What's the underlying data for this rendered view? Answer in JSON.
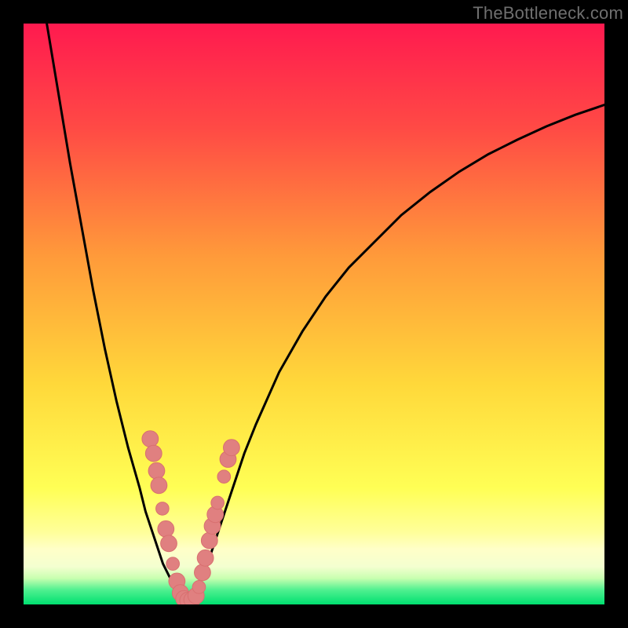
{
  "watermark": "TheBottleneck.com",
  "colors": {
    "gradient_top": "#ff1a4f",
    "gradient_mid_upper": "#ff7a3a",
    "gradient_mid": "#ffd83a",
    "gradient_lower_yellow": "#ffff66",
    "gradient_pale_band": "#ffffc0",
    "gradient_green": "#00e86b",
    "curve": "#000000",
    "marker_fill": "#e08080",
    "marker_stroke": "#d87070"
  },
  "chart_data": {
    "type": "line",
    "title": "",
    "xlabel": "",
    "ylabel": "",
    "xlim": [
      0,
      100
    ],
    "ylim": [
      0,
      100
    ],
    "curve_left": {
      "x": [
        4,
        6,
        8,
        10,
        12,
        14,
        16,
        18,
        20,
        21,
        22,
        23,
        24,
        25,
        26,
        27,
        28
      ],
      "y": [
        100,
        88,
        76,
        65,
        54,
        44,
        35,
        27,
        20,
        16,
        13,
        10,
        7,
        5,
        3,
        1.5,
        0.5
      ]
    },
    "curve_right": {
      "x": [
        28,
        30,
        32,
        34,
        36,
        38,
        40,
        44,
        48,
        52,
        56,
        60,
        65,
        70,
        75,
        80,
        85,
        90,
        95,
        100
      ],
      "y": [
        0.5,
        3,
        8,
        14,
        20,
        26,
        31,
        40,
        47,
        53,
        58,
        62,
        67,
        71,
        74.5,
        77.5,
        80,
        82.3,
        84.3,
        86
      ]
    },
    "markers": [
      {
        "x": 21.8,
        "y": 28.5,
        "r": 2.0
      },
      {
        "x": 22.4,
        "y": 26.0,
        "r": 2.0
      },
      {
        "x": 22.9,
        "y": 23.0,
        "r": 2.0
      },
      {
        "x": 23.3,
        "y": 20.5,
        "r": 2.0
      },
      {
        "x": 23.9,
        "y": 16.5,
        "r": 1.6
      },
      {
        "x": 24.5,
        "y": 13.0,
        "r": 2.0
      },
      {
        "x": 25.0,
        "y": 10.5,
        "r": 2.0
      },
      {
        "x": 25.7,
        "y": 7.0,
        "r": 1.6
      },
      {
        "x": 26.4,
        "y": 4.0,
        "r": 2.0
      },
      {
        "x": 27.0,
        "y": 2.0,
        "r": 2.0
      },
      {
        "x": 27.6,
        "y": 1.0,
        "r": 2.0
      },
      {
        "x": 28.3,
        "y": 0.7,
        "r": 2.0
      },
      {
        "x": 29.0,
        "y": 0.8,
        "r": 2.0
      },
      {
        "x": 29.7,
        "y": 1.5,
        "r": 2.0
      },
      {
        "x": 30.2,
        "y": 3.0,
        "r": 1.6
      },
      {
        "x": 30.8,
        "y": 5.5,
        "r": 2.0
      },
      {
        "x": 31.3,
        "y": 8.0,
        "r": 2.0
      },
      {
        "x": 32.0,
        "y": 11.0,
        "r": 2.0
      },
      {
        "x": 32.5,
        "y": 13.5,
        "r": 2.0
      },
      {
        "x": 33.0,
        "y": 15.5,
        "r": 2.0
      },
      {
        "x": 33.4,
        "y": 17.5,
        "r": 1.6
      },
      {
        "x": 34.5,
        "y": 22.0,
        "r": 1.6
      },
      {
        "x": 35.2,
        "y": 25.0,
        "r": 2.0
      },
      {
        "x": 35.8,
        "y": 27.0,
        "r": 2.0
      }
    ]
  }
}
